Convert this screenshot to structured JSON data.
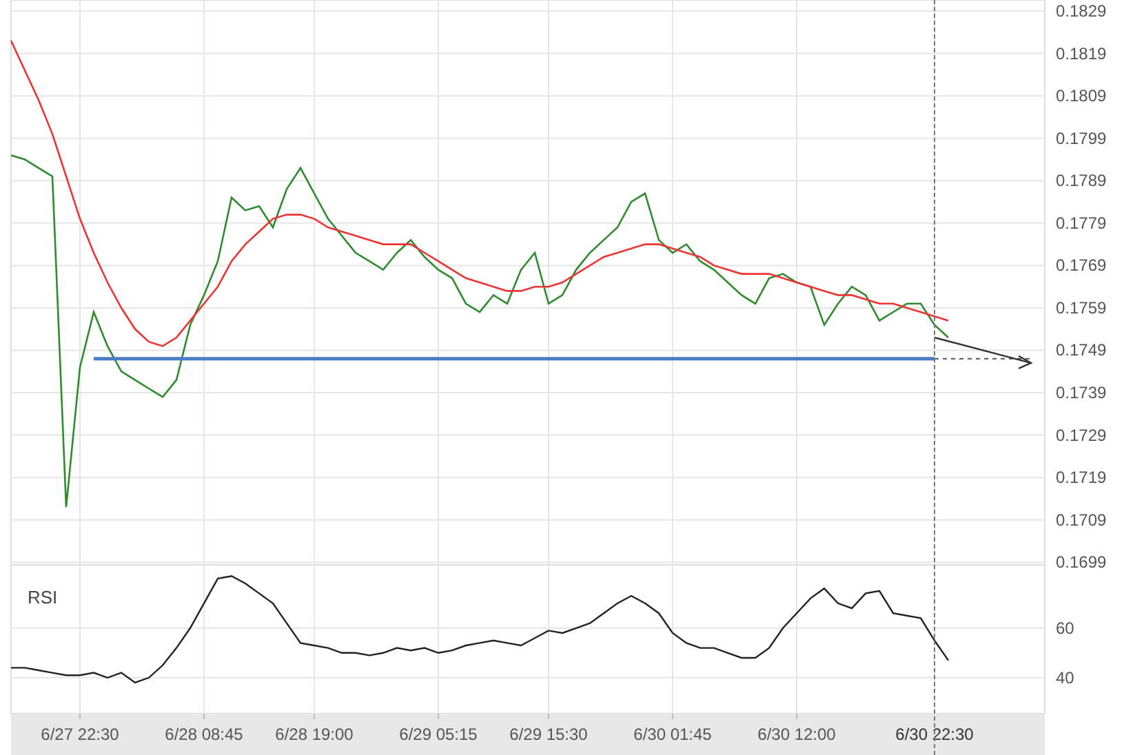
{
  "price_chart": {
    "chart_data": {
      "type": "line",
      "grid": true,
      "ylim": [
        0.16984,
        0.18316
      ],
      "yticks": [
        {
          "value": 0.1829,
          "label": "0.1829"
        },
        {
          "value": 0.1819,
          "label": "0.1819"
        },
        {
          "value": 0.1809,
          "label": "0.1809"
        },
        {
          "value": 0.1799,
          "label": "0.1799"
        },
        {
          "value": 0.1789,
          "label": "0.1789"
        },
        {
          "value": 0.1779,
          "label": "0.1779"
        },
        {
          "value": 0.1769,
          "label": "0.1769"
        },
        {
          "value": 0.1759,
          "label": "0.1759"
        },
        {
          "value": 0.1749,
          "label": "0.1749"
        },
        {
          "value": 0.1739,
          "label": "0.1739"
        },
        {
          "value": 0.1729,
          "label": "0.1729"
        },
        {
          "value": 0.1719,
          "label": "0.1719"
        },
        {
          "value": 0.1709,
          "label": "0.1709"
        },
        {
          "value": 0.1699,
          "label": "0.1699"
        }
      ],
      "categories": [
        null,
        null,
        null,
        null,
        null,
        null,
        null,
        null,
        null,
        null,
        null,
        null,
        null,
        null,
        null,
        null,
        null,
        null,
        null,
        null,
        null,
        null,
        null,
        null,
        null,
        null,
        null,
        null,
        null,
        null,
        null,
        null,
        null,
        null,
        null,
        null,
        null,
        null,
        null,
        null,
        null,
        null,
        null,
        null,
        null,
        null,
        null,
        null,
        null,
        null,
        null,
        null,
        null,
        null,
        null,
        null,
        null,
        null,
        null,
        null,
        null,
        null,
        null,
        null,
        null,
        null,
        null,
        null,
        null,
        null,
        null,
        null,
        null,
        null,
        null
      ],
      "series": [
        {
          "color": "#2e8b2e",
          "values": [
            0.1795,
            0.1794,
            0.1792,
            0.179,
            0.1712,
            0.1745,
            0.1758,
            0.175,
            0.1744,
            0.1742,
            0.174,
            0.1738,
            0.1742,
            0.1755,
            0.1762,
            0.177,
            0.1785,
            0.1782,
            0.1783,
            0.1778,
            0.1787,
            0.1792,
            0.1786,
            0.178,
            0.1776,
            0.1772,
            0.177,
            0.1768,
            0.1772,
            0.1775,
            0.1771,
            0.1768,
            0.1766,
            0.176,
            0.1758,
            0.1762,
            0.176,
            0.1768,
            0.1772,
            0.176,
            0.1762,
            0.1768,
            0.1772,
            0.1775,
            0.1778,
            0.1784,
            0.1786,
            0.1775,
            0.1772,
            0.1774,
            0.177,
            0.1768,
            0.1765,
            0.1762,
            0.176,
            0.1766,
            0.1767,
            0.1765,
            0.1764,
            0.1755,
            0.176,
            0.1764,
            0.1762,
            0.1756,
            0.1758,
            0.176,
            0.176,
            0.1755,
            0.1752,
            null,
            null,
            null,
            null,
            null,
            null
          ]
        },
        {
          "color": "#ee3333",
          "values": [
            0.1822,
            0.1815,
            0.1808,
            0.18,
            0.179,
            0.178,
            0.1772,
            0.1765,
            0.1759,
            0.1754,
            0.1751,
            0.175,
            0.1752,
            0.1756,
            0.176,
            0.1764,
            0.177,
            0.1774,
            0.1777,
            0.178,
            0.1781,
            0.1781,
            0.178,
            0.1778,
            0.1777,
            0.1776,
            0.1775,
            0.1774,
            0.1774,
            0.1774,
            0.1772,
            0.177,
            0.1768,
            0.1766,
            0.1765,
            0.1764,
            0.1763,
            0.1763,
            0.1764,
            0.1764,
            0.1765,
            0.1767,
            0.1769,
            0.1771,
            0.1772,
            0.1773,
            0.1774,
            0.1774,
            0.1773,
            0.1772,
            0.1771,
            0.1769,
            0.1768,
            0.1767,
            0.1767,
            0.1767,
            0.1766,
            0.1765,
            0.1764,
            0.1763,
            0.1762,
            0.1762,
            0.1761,
            0.176,
            0.176,
            0.1759,
            0.1758,
            0.1757,
            0.1756,
            null,
            null,
            null,
            null,
            null,
            null
          ]
        },
        {
          "color": "#4a7cc9",
          "values": [
            null,
            null,
            null,
            null,
            null,
            null,
            0.1747,
            0.1747,
            0.1747,
            0.1747,
            0.1747,
            0.1747,
            0.1747,
            0.1747,
            0.1747,
            0.1747,
            0.1747,
            0.1747,
            0.1747,
            0.1747,
            0.1747,
            0.1747,
            0.1747,
            0.1747,
            0.1747,
            0.1747,
            0.1747,
            0.1747,
            0.1747,
            0.1747,
            0.1747,
            0.1747,
            0.1747,
            0.1747,
            0.1747,
            0.1747,
            0.1747,
            0.1747,
            0.1747,
            0.1747,
            0.1747,
            0.1747,
            0.1747,
            0.1747,
            0.1747,
            0.1747,
            0.1747,
            0.1747,
            0.1747,
            0.1747,
            0.1747,
            0.1747,
            0.1747,
            0.1747,
            0.1747,
            0.1747,
            0.1747,
            0.1747,
            0.1747,
            0.1747,
            0.1747,
            0.1747,
            0.1747,
            0.1747,
            0.1747,
            0.1747,
            0.1747,
            0.1747,
            null,
            null,
            null,
            null,
            null,
            null,
            null
          ]
        },
        {
          "color": "#555555",
          "line_style": "dashed",
          "values": [
            null,
            null,
            null,
            null,
            null,
            null,
            null,
            null,
            null,
            null,
            null,
            null,
            null,
            null,
            null,
            null,
            null,
            null,
            null,
            null,
            null,
            null,
            null,
            null,
            null,
            null,
            null,
            null,
            null,
            null,
            null,
            null,
            null,
            null,
            null,
            null,
            null,
            null,
            null,
            null,
            null,
            null,
            null,
            null,
            null,
            null,
            null,
            null,
            null,
            null,
            null,
            null,
            null,
            null,
            null,
            null,
            null,
            null,
            null,
            null,
            null,
            null,
            null,
            null,
            null,
            null,
            null,
            0.1747,
            0.1747,
            0.1747,
            0.1747,
            0.1747,
            0.1747,
            0.1747,
            0.1747
          ]
        }
      ]
    }
  },
  "rsi_panel": {
    "chart_data": {
      "type": "line",
      "grid": true,
      "title": "RSI",
      "ylim": [
        25.5,
        85.5
      ],
      "yticks": [
        60,
        40
      ],
      "categories": [
        null,
        null,
        null,
        null,
        null,
        "6/27 22:30",
        null,
        null,
        null,
        null,
        null,
        null,
        null,
        null,
        "6/28 08:45",
        null,
        null,
        null,
        null,
        null,
        null,
        null,
        "6/28 19:00",
        null,
        null,
        null,
        null,
        null,
        null,
        null,
        null,
        "6/29 05:15",
        null,
        null,
        null,
        null,
        null,
        null,
        null,
        "6/29 15:30",
        null,
        null,
        null,
        null,
        null,
        null,
        null,
        null,
        "6/30 01:45",
        null,
        null,
        null,
        null,
        null,
        null,
        null,
        null,
        "6/30 12:00",
        null,
        null,
        null,
        null,
        null,
        null,
        null,
        null,
        null,
        "6/30 22:30",
        null,
        null,
        null,
        null,
        null,
        null,
        null
      ],
      "series": [
        {
          "color": "#222222",
          "values": [
            44,
            44,
            43,
            42,
            41,
            41,
            42,
            40,
            42,
            38,
            40,
            45,
            52,
            60,
            70,
            80,
            81,
            78,
            74,
            70,
            62,
            54,
            53,
            52,
            50,
            50,
            49,
            50,
            52,
            51,
            52,
            50,
            51,
            53,
            54,
            55,
            54,
            53,
            56,
            59,
            58,
            60,
            62,
            66,
            70,
            73,
            70,
            66,
            58,
            54,
            52,
            52,
            50,
            48,
            48,
            52,
            60,
            66,
            72,
            76,
            70,
            68,
            74,
            75,
            66,
            65,
            64,
            55,
            47,
            null,
            null,
            null,
            null,
            null,
            null
          ]
        }
      ]
    }
  }
}
